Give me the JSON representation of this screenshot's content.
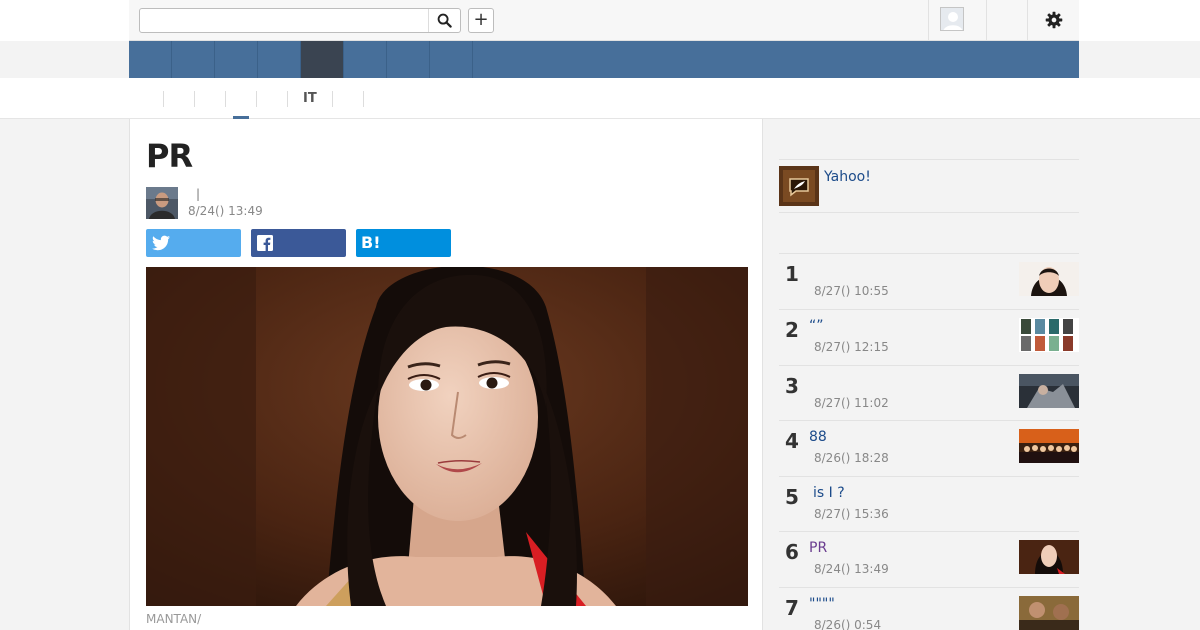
{
  "header": {
    "search": {
      "value": "",
      "placeholder": ""
    },
    "add_label": "+"
  },
  "nav": {
    "items": [
      "",
      "",
      "",
      "",
      "",
      "",
      "",
      "",
      ""
    ],
    "active_index": 5
  },
  "subnav": {
    "items": [
      "",
      "",
      "",
      "",
      "",
      "IT",
      ""
    ],
    "active_index": 3
  },
  "article": {
    "title": "PR",
    "author_sep": "|",
    "date": "8/24() 13:49",
    "caption": "MANTAN/",
    "share": {
      "hatena_label": "B!"
    }
  },
  "sidebar": {
    "yahoo_label": "Yahoo!",
    "ranking": [
      {
        "rank": "1",
        "title": "",
        "date": "8/27() 10:55",
        "visited": false
      },
      {
        "rank": "2",
        "title": "“”",
        "date": "8/27() 12:15",
        "visited": false
      },
      {
        "rank": "3",
        "title": "",
        "date": "8/27() 11:02",
        "visited": false
      },
      {
        "rank": "4",
        "title": "88",
        "date": "8/26() 18:28",
        "visited": false
      },
      {
        "rank": "5",
        "title": "is I ?",
        "date": "8/27() 15:36",
        "visited": false
      },
      {
        "rank": "6",
        "title": "PR",
        "date": "8/24() 13:49",
        "visited": true
      },
      {
        "rank": "7",
        "title": "\"\"\"\"",
        "date": "8/26() 0:54",
        "visited": false
      }
    ]
  },
  "colors": {
    "nav": "#476f9a",
    "nav_active": "#3a4451",
    "twitter": "#55acee",
    "facebook": "#3b5998",
    "hatena": "#008fde",
    "link": "#1c4b8a",
    "visited": "#6a3c8f"
  },
  "icons": [
    "search-icon",
    "plus-icon",
    "user-avatar-icon",
    "gear-icon",
    "twitter-icon",
    "facebook-icon",
    "hatena-bookmark-icon",
    "yahoo-quill-icon"
  ]
}
